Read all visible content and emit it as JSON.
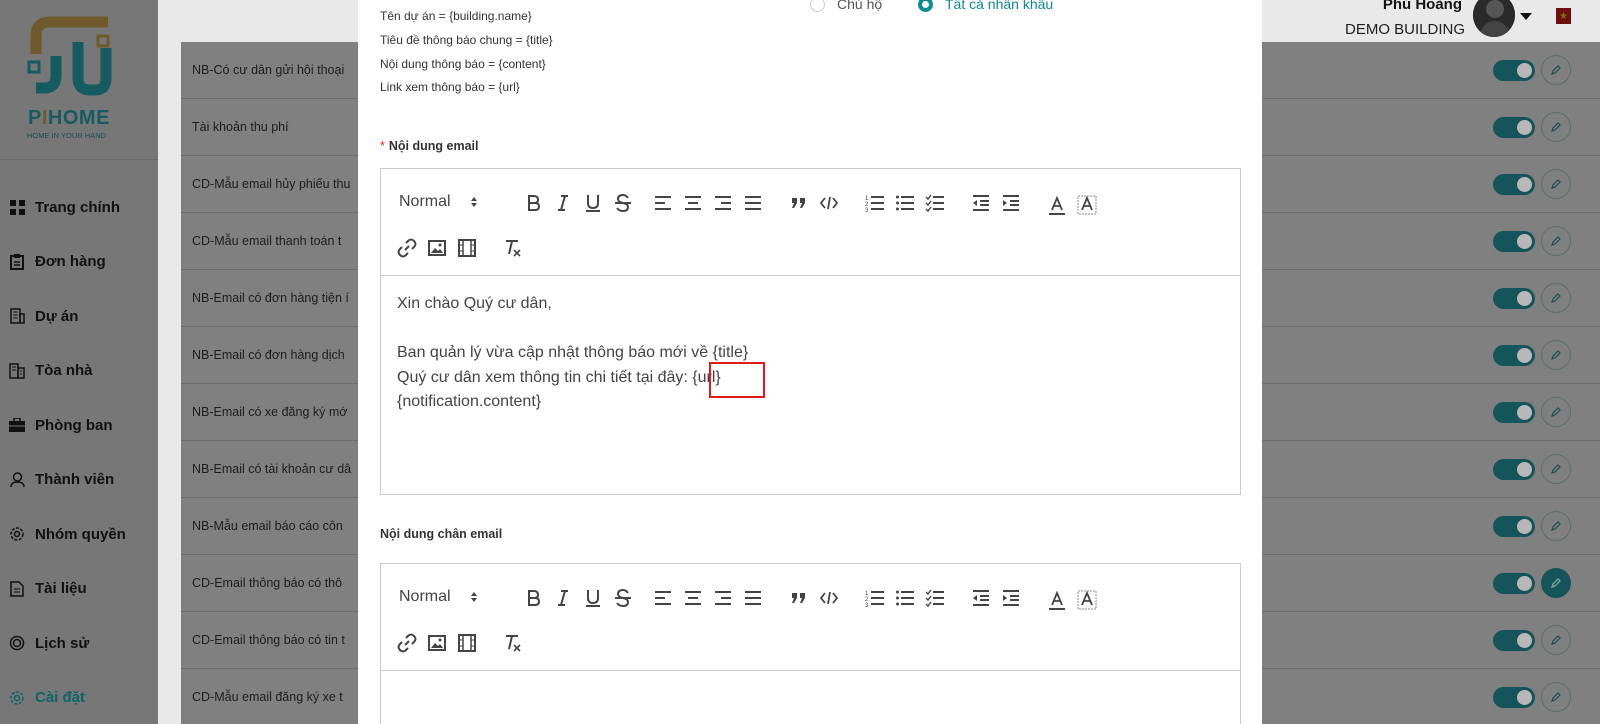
{
  "sidebar": {
    "logo_text_1": "P",
    "logo_text_i": "I",
    "logo_text_2": "HOME",
    "logo_tagline": "HOME IN YOUR HAND",
    "items": [
      {
        "label": "Trang chính",
        "icon": "grid-icon"
      },
      {
        "label": "Đơn hàng",
        "icon": "clipboard-icon"
      },
      {
        "label": "Dự án",
        "icon": "building-icon"
      },
      {
        "label": "Tòa nhà",
        "icon": "buildings-icon"
      },
      {
        "label": "Phòng ban",
        "icon": "briefcase-icon"
      },
      {
        "label": "Thành viên",
        "icon": "user-icon"
      },
      {
        "label": "Nhóm quyền",
        "icon": "gear-icon"
      },
      {
        "label": "Tài liệu",
        "icon": "document-icon"
      },
      {
        "label": "Lịch sử",
        "icon": "history-icon"
      },
      {
        "label": "Cài đặt",
        "icon": "settings-icon",
        "active": true
      }
    ]
  },
  "header": {
    "user_name": "Phú Hoàng",
    "building": "DEMO BUILDING"
  },
  "list": {
    "rows": [
      "NB-Có cư dân gửi hội thoại",
      "Tài khoản thu phí",
      "CD-Mẫu email hủy phiếu thu",
      "CD-Mẫu email thanh toán t",
      "NB-Email có đơn hàng tiện í",
      "NB-Email có đơn hàng dịch",
      "NB-Email có xe đăng ký mớ",
      "NB-Email có tài khoản cư dâ",
      "NB-Mẫu email báo cáo côn",
      "CD-Email thông báo có thô",
      "CD-Email thông báo có tin t",
      "CD-Mẫu email đăng ký xe t"
    ]
  },
  "modal": {
    "vars": [
      "Tên dự án = {building.name}",
      "Tiêu đề thông báo chung = {title}",
      "Nội dung thông báo = {content}",
      "Link xem thông báo = {url}"
    ],
    "radio_owner": "Chủ hộ",
    "radio_all": "Tất cả nhân khẩu",
    "email_label_req": "*",
    "email_label": "Nội dung email",
    "footer_label": "Nội dung chân email",
    "format_select": "Normal",
    "email_content": [
      "Xin chào Quý cư dân,",
      "",
      "Ban quản lý vừa cập nhật thông báo mới về {title}",
      "Quý cư dân xem thông tin chi tiết tại đây: {url}",
      "{notification.content}"
    ]
  }
}
